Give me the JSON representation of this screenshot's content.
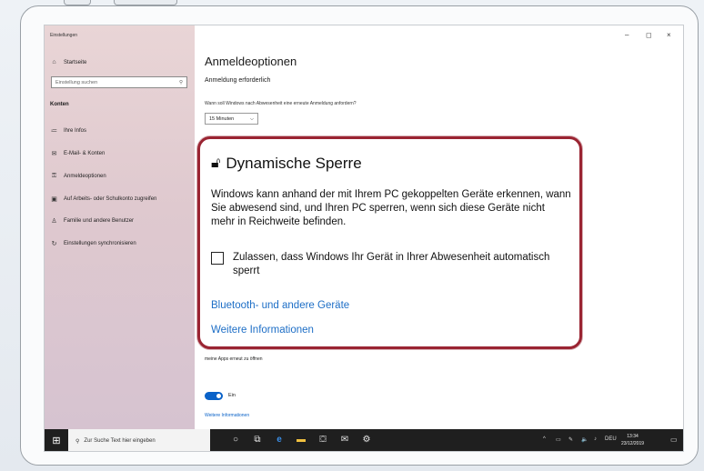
{
  "window": {
    "app_title": "Einstellungen",
    "controls": {
      "minimize": "–",
      "maximize": "◻",
      "close": "×"
    }
  },
  "sidebar": {
    "home": "Startseite",
    "search_placeholder": "Einstellung suchen",
    "section": "Konten",
    "items": [
      {
        "label": "Ihre Infos",
        "icon": "person-list-icon"
      },
      {
        "label": "E-Mail- & Konten",
        "icon": "mail-icon"
      },
      {
        "label": "Anmeldeoptionen",
        "icon": "key-icon"
      },
      {
        "label": "Auf Arbeits- oder Schulkonto zugreifen",
        "icon": "briefcase-icon"
      },
      {
        "label": "Familie und andere Benutzer",
        "icon": "people-icon"
      },
      {
        "label": "Einstellungen synchronisieren",
        "icon": "sync-icon"
      }
    ]
  },
  "main": {
    "title": "Anmeldeoptionen",
    "subheading": "Anmeldung erforderlich",
    "question": "Wann soll Windows nach Abwesenheit eine erneute Anmeldung anfordern?",
    "dropdown_value": "15 Minuten",
    "restart_text": "meine Apps erneut zu öffnen",
    "toggle_label": "Ein",
    "more_info": "Weitere Informationen"
  },
  "callout": {
    "title": "Dynamische Sperre",
    "description": "Windows kann anhand der mit Ihrem PC gekoppelten Geräte erkennen, wann Sie abwesend sind, und Ihren PC sperren, wenn sich diese Geräte nicht mehr in Reichweite befinden.",
    "checkbox_label": "Zulassen, dass Windows Ihr Gerät in Ihrer Abwesenheit automatisch sperrt",
    "checkbox_checked": false,
    "link_bluetooth": "Bluetooth- und andere Geräte",
    "link_more": "Weitere Informationen",
    "border_color": "#9a2432",
    "link_color": "#1d6ec6"
  },
  "taskbar": {
    "search_text": "Zur Suche Text hier eingeben",
    "language": "DEU",
    "time": "13:34",
    "date": "23/12/2019"
  }
}
